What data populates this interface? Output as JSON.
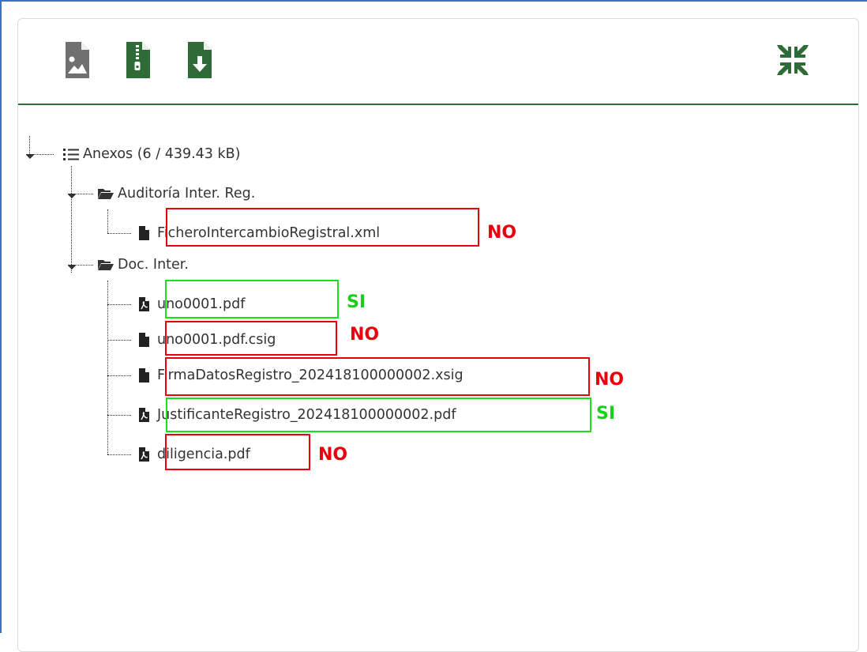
{
  "toolbar": {
    "icons": [
      "image-file-icon",
      "zip-file-icon",
      "download-file-icon",
      "collapse-icon"
    ]
  },
  "tree": {
    "root": {
      "label": "Anexos (6 / 439.43 kB)",
      "icon": "list-icon"
    },
    "folders": [
      {
        "label": "Auditoría Inter. Reg.",
        "icon": "folder-open-icon",
        "files": [
          {
            "label": "FicheroIntercambioRegistral.xml",
            "icon": "file-icon",
            "mark": "NO"
          }
        ]
      },
      {
        "label": "Doc. Inter.",
        "icon": "folder-open-icon",
        "files": [
          {
            "label": "uno0001.pdf",
            "icon": "pdf-file-icon",
            "mark": "SI"
          },
          {
            "label": "uno0001.pdf.csig",
            "icon": "file-icon",
            "mark": "NO"
          },
          {
            "label": "FirmaDatosRegistro_202418100000002.xsig",
            "icon": "file-icon",
            "mark": "NO"
          },
          {
            "label": "JustificanteRegistro_202418100000002.pdf",
            "icon": "pdf-file-icon",
            "mark": "SI"
          },
          {
            "label": "diligencia.pdf",
            "icon": "pdf-file-icon",
            "mark": "NO"
          }
        ]
      }
    ]
  },
  "colors": {
    "green_dark": "#2e6b36",
    "gray_icon": "#707070",
    "mark_no": "#e8000b",
    "mark_si": "#18d018"
  }
}
